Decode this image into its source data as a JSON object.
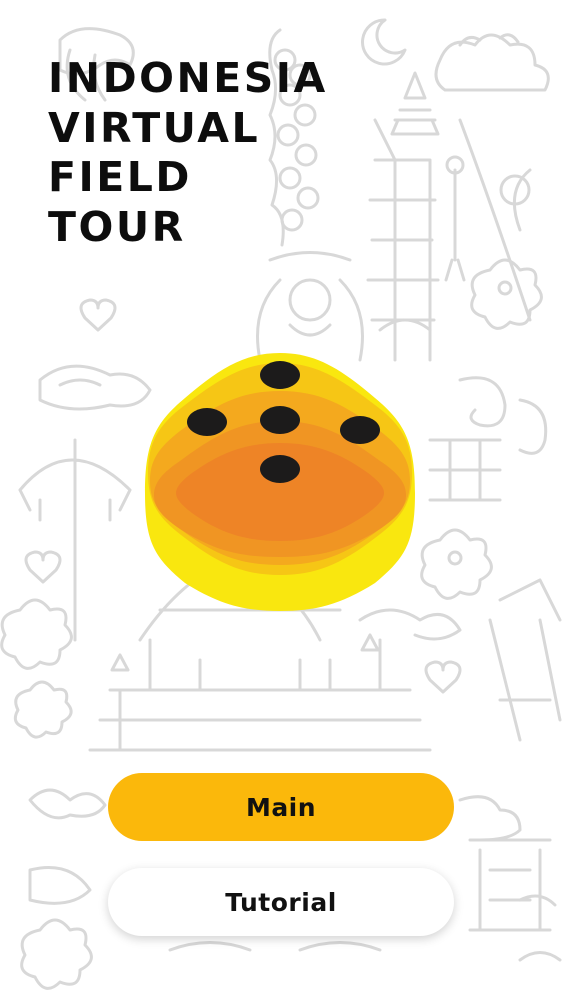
{
  "app": {
    "title_lines": [
      "INDONESIA",
      "VIRTUAL",
      "FIELD",
      "TOUR"
    ]
  },
  "logo": {
    "icon": "layered-hexagon-dice-icon",
    "colors": [
      "#f9e70f",
      "#f6c615",
      "#f4a91e",
      "#ee8528",
      "#1c1b1b"
    ]
  },
  "menu": {
    "main_label": "Main",
    "tutorial_label": "Tutorial"
  },
  "theme": {
    "accent": "#fbb80b",
    "doodle_stroke": "#d9d9d9"
  }
}
